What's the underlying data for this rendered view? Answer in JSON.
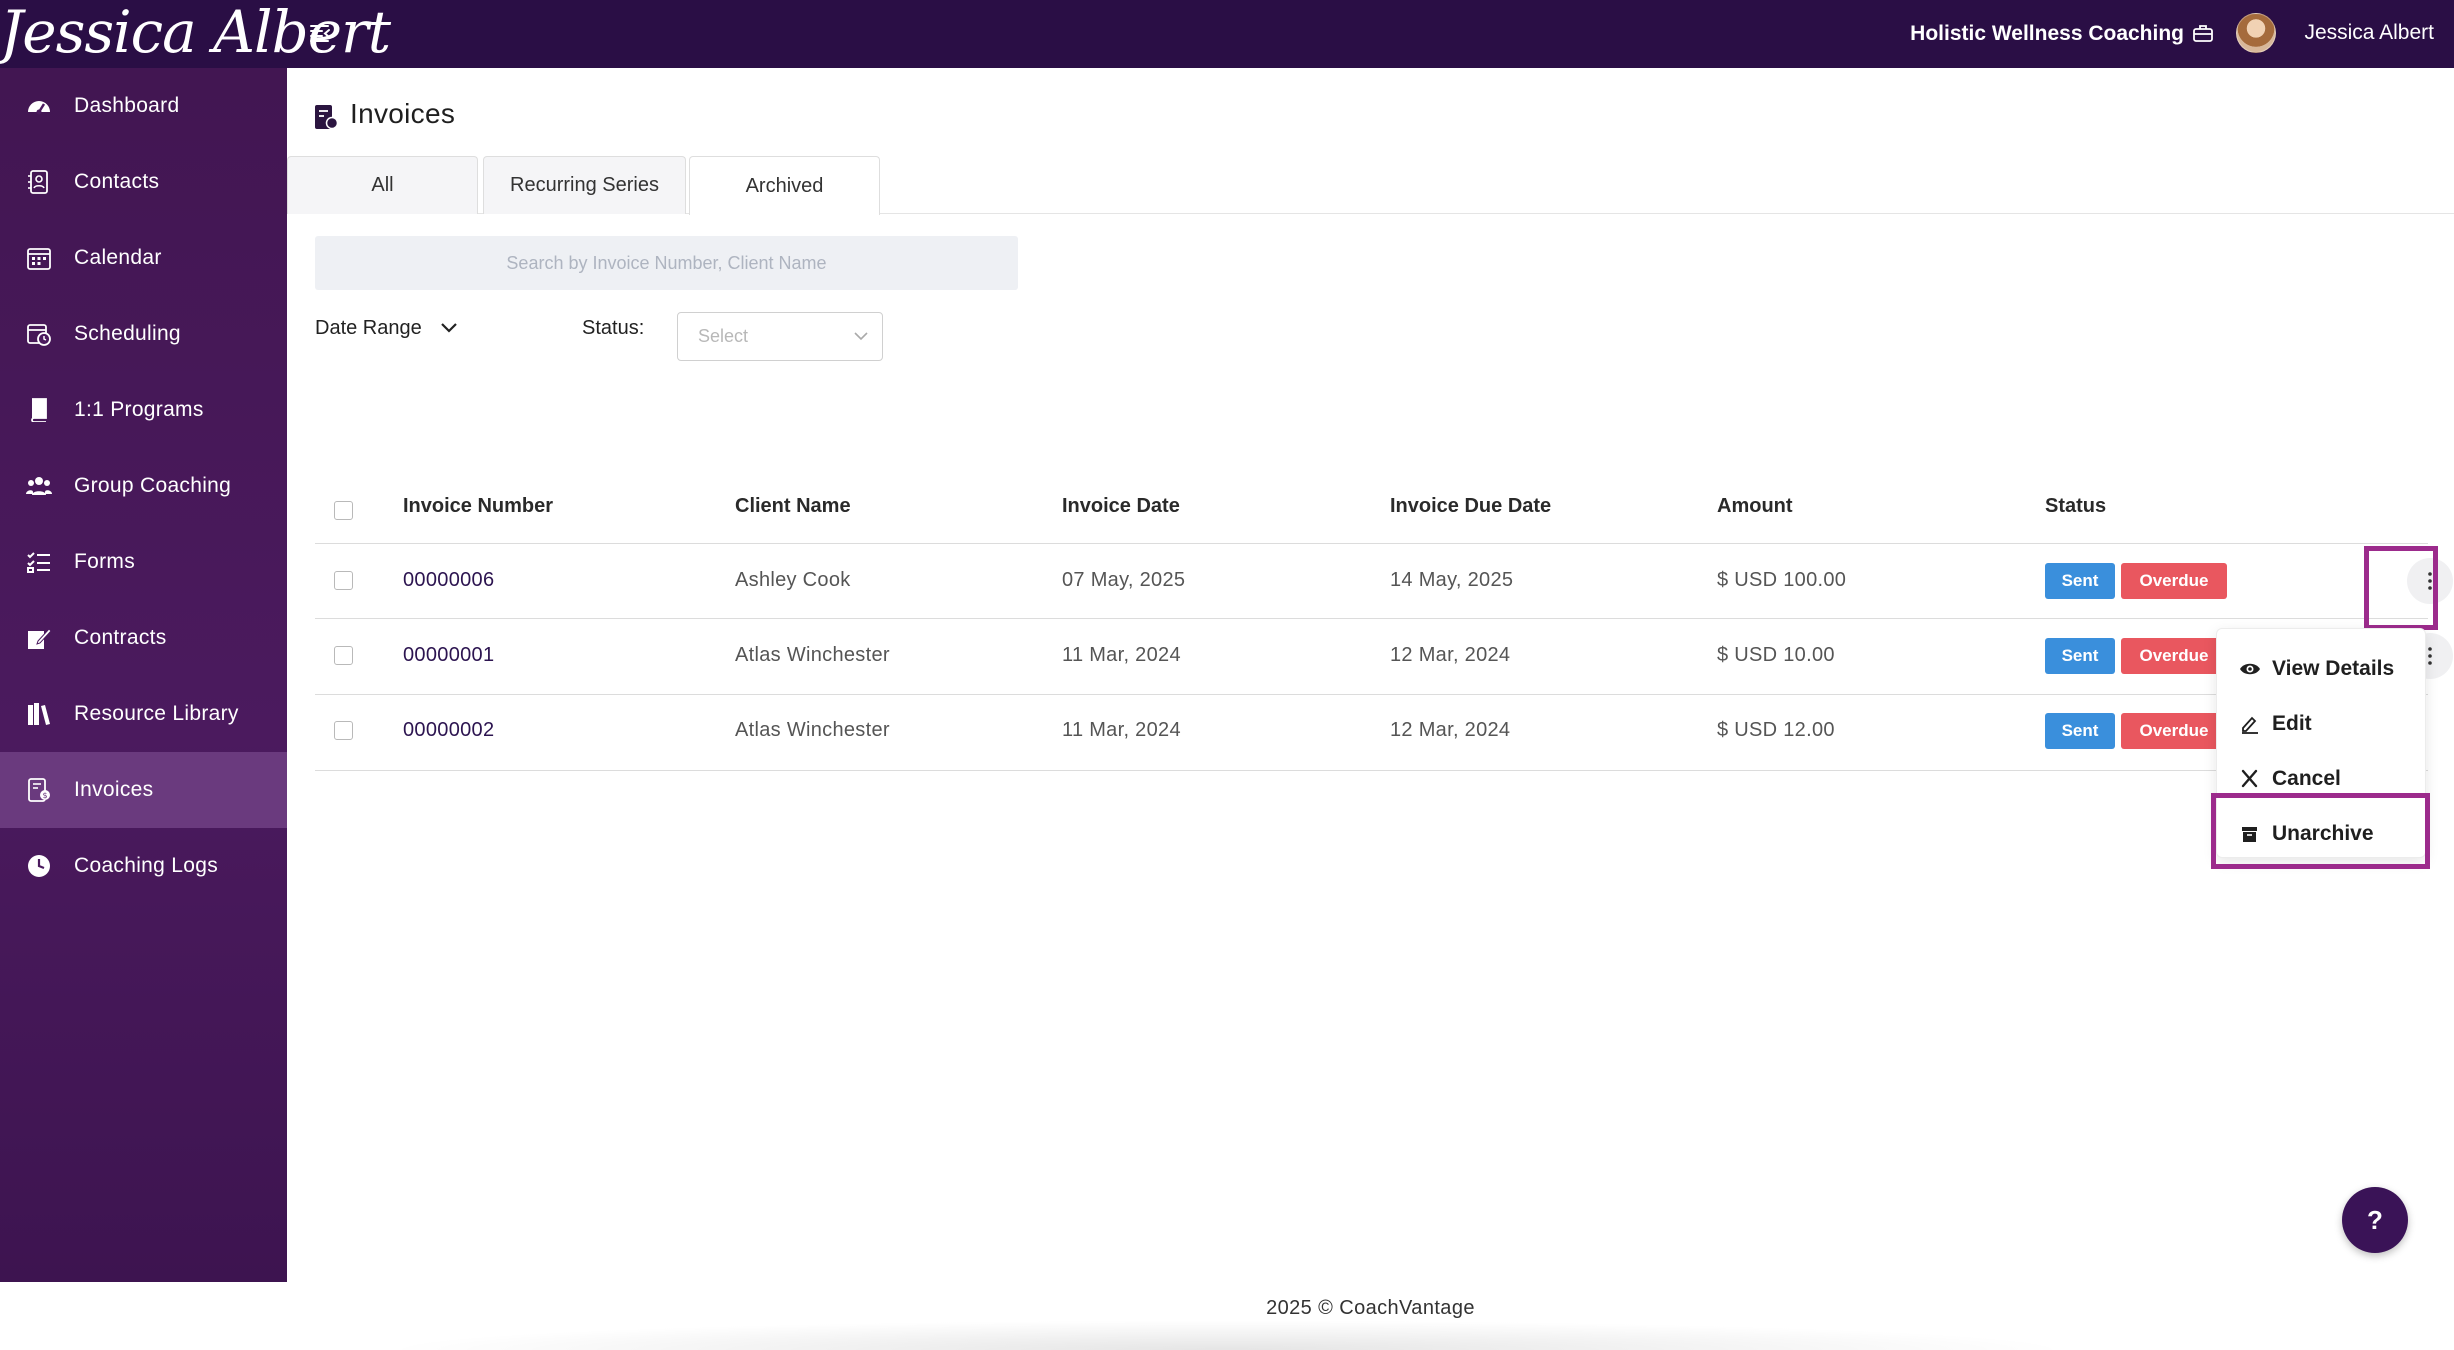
{
  "app": {
    "logo_text": "Jessica Albert",
    "org_name": "Holistic Wellness Coaching",
    "user_name": "Jessica Albert"
  },
  "sidebar": {
    "items": [
      {
        "label": "Dashboard",
        "icon": "dashboard-icon"
      },
      {
        "label": "Contacts",
        "icon": "contacts-icon"
      },
      {
        "label": "Calendar",
        "icon": "calendar-icon"
      },
      {
        "label": "Scheduling",
        "icon": "scheduling-icon"
      },
      {
        "label": "1:1 Programs",
        "icon": "book-icon"
      },
      {
        "label": "Group Coaching",
        "icon": "group-icon"
      },
      {
        "label": "Forms",
        "icon": "forms-icon"
      },
      {
        "label": "Contracts",
        "icon": "contract-icon"
      },
      {
        "label": "Resource Library",
        "icon": "library-icon"
      },
      {
        "label": "Invoices",
        "icon": "invoice-icon",
        "active": true
      },
      {
        "label": "Coaching Logs",
        "icon": "clock-icon"
      }
    ]
  },
  "page": {
    "title": "Invoices",
    "tabs": [
      {
        "label": "All"
      },
      {
        "label": "Recurring Series"
      },
      {
        "label": "Archived",
        "active": true
      }
    ],
    "search": {
      "placeholder": "Search by Invoice Number, Client Name",
      "value": ""
    },
    "filters": {
      "date_range_label": "Date Range",
      "status_label": "Status:",
      "status_placeholder": "Select"
    }
  },
  "table": {
    "columns": [
      "Invoice Number",
      "Client Name",
      "Invoice Date",
      "Invoice Due Date",
      "Amount",
      "Status"
    ],
    "rows": [
      {
        "number": "00000006",
        "client": "Ashley Cook",
        "date": "07 May, 2025",
        "due": "14 May, 2025",
        "amount": "$ USD 100.00",
        "statuses": [
          "Sent",
          "Overdue"
        ]
      },
      {
        "number": "00000001",
        "client": "Atlas Winchester",
        "date": "11 Mar, 2024",
        "due": "12 Mar, 2024",
        "amount": "$ USD 10.00",
        "statuses": [
          "Sent",
          "Overdue"
        ]
      },
      {
        "number": "00000002",
        "client": "Atlas Winchester",
        "date": "11 Mar, 2024",
        "due": "12 Mar, 2024",
        "amount": "$ USD 12.00",
        "statuses": [
          "Sent",
          "Overdue"
        ]
      }
    ]
  },
  "row_menu": {
    "items": [
      {
        "label": "View Details",
        "icon": "eye-icon"
      },
      {
        "label": "Edit",
        "icon": "pencil-icon"
      },
      {
        "label": "Cancel",
        "icon": "close-icon"
      },
      {
        "label": "Unarchive",
        "icon": "archive-icon"
      }
    ]
  },
  "footer": {
    "text": "2025 © CoachVantage"
  },
  "help_label": "?",
  "colors": {
    "topbar": "#2a0e45",
    "sidebar": "#4b1a5e",
    "sidebar_active": "#6a3a7e",
    "sent_badge": "#3a8fdc",
    "overdue_badge": "#e9575f",
    "highlight": "#9c2b8c"
  }
}
